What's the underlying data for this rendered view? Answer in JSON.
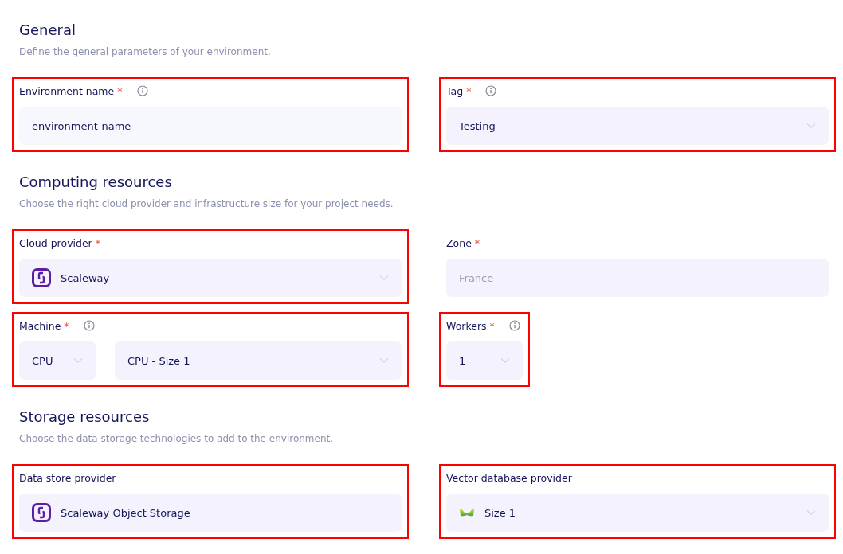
{
  "sections": [
    {
      "title": "General",
      "description": "Define the general parameters of your environment.",
      "fields": [
        {
          "label": "Environment name",
          "required": "*",
          "info": true,
          "highlighted": true,
          "controls": [
            {
              "kind": "input",
              "value": "environment-name"
            }
          ]
        },
        {
          "label": "Tag",
          "required": "*",
          "info": true,
          "highlighted": true,
          "controls": [
            {
              "kind": "select",
              "value": "Testing",
              "disabled": false,
              "chevron": true
            }
          ]
        }
      ]
    },
    {
      "title": "Computing resources",
      "description": "Choose the right cloud provider and infrastructure size for your project needs.",
      "fields": [
        {
          "label": "Cloud provider",
          "required": "*",
          "info": false,
          "highlighted": true,
          "controls": [
            {
              "kind": "logo-select",
              "value": "Scaleway",
              "disabled": false,
              "chevron": true
            }
          ]
        },
        {
          "label": "Zone",
          "required": "*",
          "info": false,
          "highlighted": false,
          "controls": [
            {
              "kind": "select",
              "value": "France",
              "disabled": true,
              "chevron": false
            }
          ]
        },
        {
          "label": "Machine",
          "required": "*",
          "info": true,
          "highlighted": true,
          "controls": [
            {
              "kind": "compact-select",
              "value": "CPU",
              "disabled": false,
              "chevron": true
            },
            {
              "kind": "select",
              "value": "CPU - Size 1",
              "disabled": false,
              "chevron": true
            }
          ]
        },
        {
          "label": "Workers",
          "required": "*",
          "info": true,
          "highlighted": true,
          "controls": [
            {
              "kind": "compact-select",
              "value": "1",
              "disabled": false,
              "chevron": true
            }
          ]
        }
      ]
    },
    {
      "title": "Storage resources",
      "description": "Choose the data storage technologies to add to the environment.",
      "fields": [
        {
          "label": "Data store provider",
          "info": false,
          "highlighted": true,
          "controls": [
            {
              "kind": "logo-select",
              "value": "Scaleway Object Storage",
              "disabled": false,
              "chevron": false
            }
          ]
        },
        {
          "label": "Vector database provider",
          "info": false,
          "highlighted": true,
          "controls": [
            {
              "kind": "wave-select",
              "value": "Size 1",
              "disabled": false,
              "chevron": true
            }
          ]
        }
      ]
    }
  ]
}
